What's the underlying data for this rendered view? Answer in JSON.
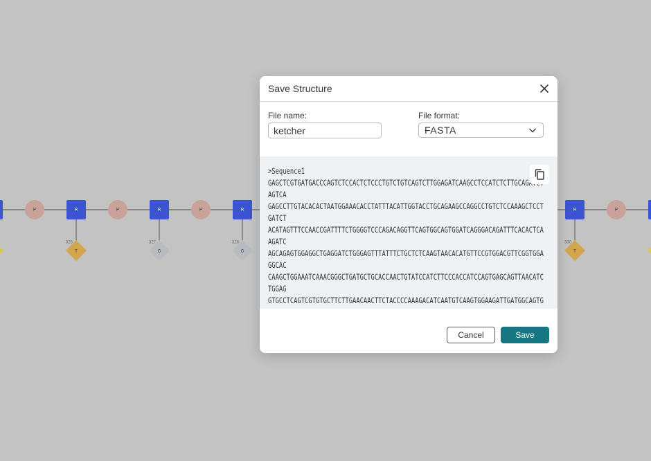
{
  "dialog": {
    "title": "Save Structure",
    "file_name_label": "File name:",
    "file_name_value": "ketcher",
    "file_format_label": "File format:",
    "file_format_value": "FASTA",
    "preview_text": ">Sequence1\nGAGCTCGTGATGACCCAGTCTCCACTCTCCCTGTCTGTCAGTCTTGGAGATCAAGCCTCCATCTCTTGCAGATCTAGTCA\nGAGCCTTGTACACACTAATGGAAACACCTATTTACATTGGTACCTGCAGAAGCCAGGCCTGTCTCCAAAGCTCCTGATCT\nACATAGTTTCCAACCGATTTTCTGGGGTCCCAGACAGGTTCAGTGGCAGTGGATCAGGGACAGATTTCACACTCAAGATC\nAGCAGAGTGGAGGCTGAGGATCTGGGAGTTTATTTCTGCTCTCAAGTAACACATGTTCCGTGGACGTTCGGTGGAGGCAC\nCAAGCTGGAAATCAAACGGGCTGATGCTGCACCAACTGTATCCATCTTCCCACCATCCAGTGAGCAGTTAACATCTGGAG\nGTGCCTCAGTCGTGTGCTTCTTGAACAACTTCTACCCCAAAGACATCAATGTCAAGTGGAAGATTGATGGCAGTGAACGA",
    "cancel_label": "Cancel",
    "save_label": "Save"
  },
  "canvas": {
    "phosphate_label": "P",
    "sugar_label": "R",
    "colors": {
      "background": "#c3c3c3",
      "sugar": "#3c54d0",
      "phosphate": "#c9a39a",
      "base_T": "#d3a54d",
      "base_G": "#b8bcc1",
      "base_yellow": "#d8cb4a",
      "accent": "#167782"
    },
    "bases": [
      {
        "label": "T",
        "number": "326"
      },
      {
        "label": "G",
        "number": "327"
      },
      {
        "label": "G",
        "number": "328"
      },
      {
        "label": "T",
        "number": "330"
      }
    ]
  }
}
